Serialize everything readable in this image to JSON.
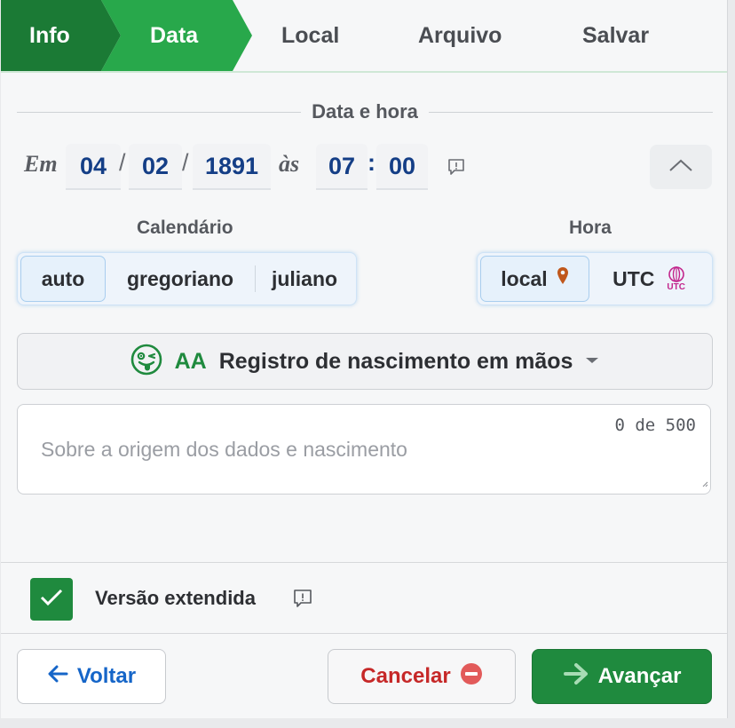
{
  "steps": [
    {
      "label": "Info"
    },
    {
      "label": "Data"
    },
    {
      "label": "Local"
    },
    {
      "label": "Arquivo"
    },
    {
      "label": "Salvar"
    }
  ],
  "section_title": "Data e hora",
  "date": {
    "prefix": "Em",
    "day": "04",
    "month": "02",
    "year": "1891",
    "sep": "/",
    "time_prefix": "às",
    "hour": "07",
    "minute": "00",
    "time_sep": ":"
  },
  "calendar": {
    "label": "Calendário",
    "options": [
      "auto",
      "gregoriano",
      "juliano"
    ],
    "selected": "auto"
  },
  "hour_mode": {
    "label": "Hora",
    "options": [
      "local",
      "UTC"
    ],
    "utc_badge": "UTC",
    "selected": "local"
  },
  "source": {
    "code": "AA",
    "label": "Registro de nascimento em mãos"
  },
  "notes": {
    "counter": "0 de 500",
    "placeholder": "Sobre a origem dos dados e nascimento"
  },
  "extended": {
    "label": "Versão extendida",
    "checked": true
  },
  "buttons": {
    "back": "Voltar",
    "cancel": "Cancelar",
    "next": "Avançar"
  },
  "colors": {
    "step_done": "#1b7a35",
    "step_active": "#28a84b",
    "primary_green": "#1f8a3e",
    "back_blue": "#1565c8",
    "cancel_red": "#c62828",
    "date_value": "#143e86"
  }
}
